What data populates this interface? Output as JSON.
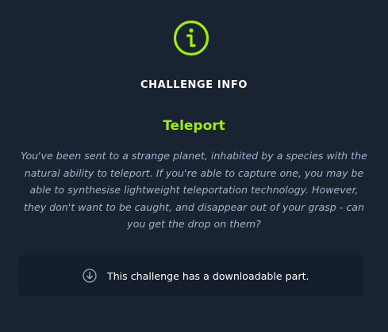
{
  "header": {
    "icon": "info-circle-icon",
    "title": "CHALLENGE INFO"
  },
  "challenge": {
    "name": "Teleport",
    "description": "You've been sent to a strange planet, inhabited by a species with the natural ability to teleport. If you're able to capture one, you may be able to synthesise lightweight teleportation technology. However, they don't want to be caught, and disappear out of your grasp - can you get the drop on them?"
  },
  "download": {
    "icon": "download-circle-icon",
    "text": "This challenge has a downloadable part."
  },
  "colors": {
    "background": "#1a2332",
    "accent": "#9fef00",
    "description_text": "#a4b1cd",
    "download_box": "#141d2b"
  }
}
